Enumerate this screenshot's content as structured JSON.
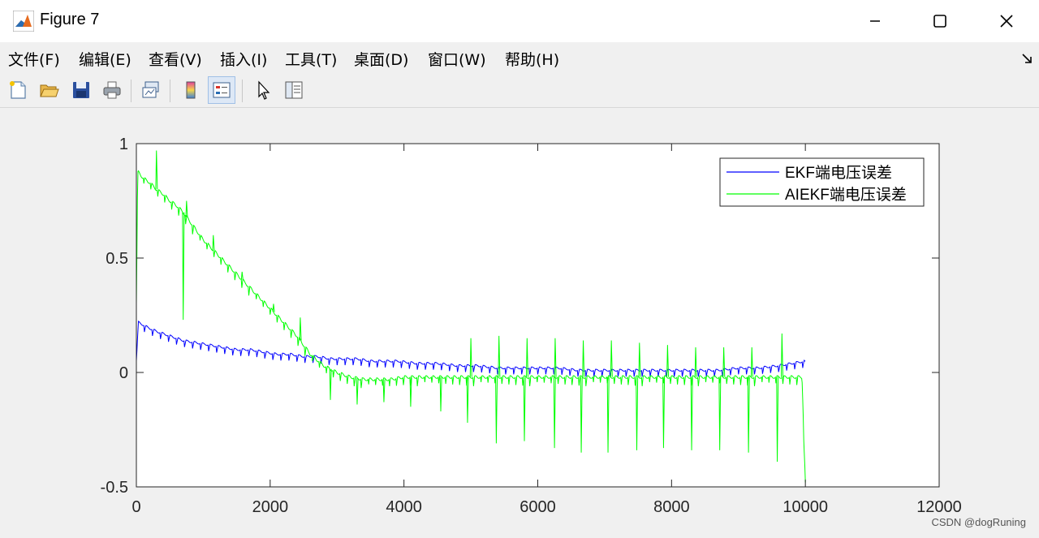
{
  "window": {
    "title": "Figure 7",
    "icon": "matlab-icon",
    "controls": [
      "minimize-icon",
      "maximize-icon",
      "close-icon"
    ]
  },
  "menu": [
    {
      "label": "文件(F)"
    },
    {
      "label": "编辑(E)"
    },
    {
      "label": "查看(V)"
    },
    {
      "label": "插入(I)"
    },
    {
      "label": "工具(T)"
    },
    {
      "label": "桌面(D)"
    },
    {
      "label": "窗口(W)"
    },
    {
      "label": "帮助(H)"
    }
  ],
  "toolbar": {
    "buttons": [
      "new-figure-icon",
      "open-icon",
      "save-icon",
      "print-icon",
      "link-plot-icon",
      "colorbar-icon",
      "legend-icon",
      "edit-plot-icon",
      "property-inspector-icon"
    ]
  },
  "watermark": "CSDN @dogRuning",
  "chart_data": {
    "type": "line",
    "title": "",
    "xlabel": "",
    "ylabel": "",
    "xlim": [
      0,
      12000
    ],
    "ylim": [
      -0.5,
      1.0
    ],
    "xticks": [
      0,
      2000,
      4000,
      6000,
      8000,
      10000,
      12000
    ],
    "yticks": [
      -0.5,
      0,
      0.5,
      1
    ],
    "xtick_labels": [
      "0",
      "2000",
      "4000",
      "6000",
      "8000",
      "10000",
      "12000"
    ],
    "ytick_labels": [
      "-0.5",
      "0",
      "0.5",
      "1"
    ],
    "grid": false,
    "legend_position": "top-right",
    "series": [
      {
        "name": "EKF端电压误差",
        "color": "#0000ff",
        "x": [
          0,
          30,
          150,
          300,
          500,
          700,
          900,
          1100,
          1300,
          1500,
          1700,
          1900,
          2100,
          2300,
          2500,
          2700,
          2900,
          3100,
          3300,
          3500,
          3700,
          3900,
          4200,
          4500,
          4800,
          5100,
          5400,
          5700,
          6000,
          6300,
          6600,
          6900,
          7200,
          7500,
          7800,
          8100,
          8400,
          8700,
          9000,
          9300,
          9600,
          9800,
          10000
        ],
        "y": [
          0.05,
          0.22,
          0.2,
          0.18,
          0.16,
          0.14,
          0.13,
          0.12,
          0.11,
          0.1,
          0.1,
          0.09,
          0.08,
          0.08,
          0.07,
          0.07,
          0.06,
          0.06,
          0.06,
          0.05,
          0.05,
          0.05,
          0.04,
          0.04,
          0.03,
          0.03,
          0.02,
          0.02,
          0.02,
          0.02,
          0.01,
          0.01,
          0.01,
          0.01,
          0.01,
          0.01,
          0.01,
          0.01,
          0.02,
          0.02,
          0.03,
          0.04,
          0.05
        ]
      },
      {
        "name": "AIEKF端电压误差",
        "color": "#00ff00",
        "x": [
          0,
          20,
          100,
          200,
          300,
          400,
          500,
          600,
          700,
          800,
          900,
          1000,
          1100,
          1200,
          1300,
          1400,
          1500,
          1600,
          1700,
          1800,
          1900,
          2000,
          2100,
          2200,
          2300,
          2400,
          2500,
          2600,
          2800,
          3000,
          3200,
          3400,
          3600,
          3800,
          4000,
          4300,
          4600,
          4900,
          5200,
          5500,
          5800,
          6100,
          6400,
          6700,
          7000,
          7300,
          7600,
          7900,
          8200,
          8500,
          8800,
          9100,
          9400,
          9700,
          9950,
          10000
        ],
        "y": [
          0.3,
          0.88,
          0.85,
          0.83,
          0.8,
          0.78,
          0.75,
          0.73,
          0.7,
          0.66,
          0.62,
          0.58,
          0.55,
          0.52,
          0.49,
          0.46,
          0.43,
          0.4,
          0.37,
          0.34,
          0.31,
          0.28,
          0.25,
          0.22,
          0.19,
          0.16,
          0.12,
          0.08,
          0.03,
          0.0,
          -0.02,
          -0.03,
          -0.03,
          -0.03,
          -0.02,
          -0.02,
          -0.02,
          -0.02,
          -0.02,
          -0.02,
          -0.02,
          -0.02,
          -0.02,
          -0.02,
          -0.02,
          -0.02,
          -0.02,
          -0.02,
          -0.02,
          -0.02,
          -0.02,
          -0.02,
          -0.02,
          -0.02,
          -0.02,
          -0.48
        ]
      }
    ],
    "spikes": [
      {
        "series": 1,
        "x": 300,
        "y": 0.97
      },
      {
        "series": 1,
        "x": 700,
        "y": 0.23
      },
      {
        "series": 1,
        "x": 750,
        "y": 0.75
      },
      {
        "series": 1,
        "x": 1150,
        "y": 0.6
      },
      {
        "series": 1,
        "x": 1580,
        "y": 0.44
      },
      {
        "series": 1,
        "x": 2050,
        "y": 0.3
      },
      {
        "series": 1,
        "x": 2450,
        "y": 0.24
      },
      {
        "series": 1,
        "x": 2900,
        "y": -0.12
      },
      {
        "series": 1,
        "x": 3300,
        "y": -0.14
      },
      {
        "series": 1,
        "x": 3700,
        "y": -0.13
      },
      {
        "series": 1,
        "x": 4100,
        "y": -0.15
      },
      {
        "series": 1,
        "x": 4550,
        "y": -0.17
      },
      {
        "series": 1,
        "x": 4950,
        "y": -0.22
      },
      {
        "series": 1,
        "x": 5380,
        "y": -0.31
      },
      {
        "series": 1,
        "x": 5800,
        "y": -0.3
      },
      {
        "series": 1,
        "x": 6250,
        "y": -0.33
      },
      {
        "series": 1,
        "x": 6650,
        "y": -0.35
      },
      {
        "series": 1,
        "x": 7050,
        "y": -0.35
      },
      {
        "series": 1,
        "x": 7480,
        "y": -0.34
      },
      {
        "series": 1,
        "x": 7880,
        "y": -0.33
      },
      {
        "series": 1,
        "x": 8300,
        "y": -0.34
      },
      {
        "series": 1,
        "x": 8720,
        "y": -0.34
      },
      {
        "series": 1,
        "x": 9150,
        "y": -0.35
      },
      {
        "series": 1,
        "x": 9580,
        "y": -0.39
      },
      {
        "series": 1,
        "x": 9650,
        "y": 0.17
      },
      {
        "series": 1,
        "x": 5000,
        "y": 0.15
      },
      {
        "series": 1,
        "x": 5420,
        "y": 0.16
      },
      {
        "series": 1,
        "x": 5840,
        "y": 0.15
      },
      {
        "series": 1,
        "x": 6260,
        "y": 0.15
      },
      {
        "series": 1,
        "x": 6680,
        "y": 0.14
      },
      {
        "series": 1,
        "x": 7100,
        "y": 0.14
      },
      {
        "series": 1,
        "x": 7520,
        "y": 0.13
      },
      {
        "series": 1,
        "x": 7940,
        "y": 0.12
      },
      {
        "series": 1,
        "x": 8360,
        "y": 0.11
      },
      {
        "series": 1,
        "x": 8780,
        "y": 0.11
      },
      {
        "series": 1,
        "x": 9200,
        "y": 0.11
      }
    ]
  }
}
